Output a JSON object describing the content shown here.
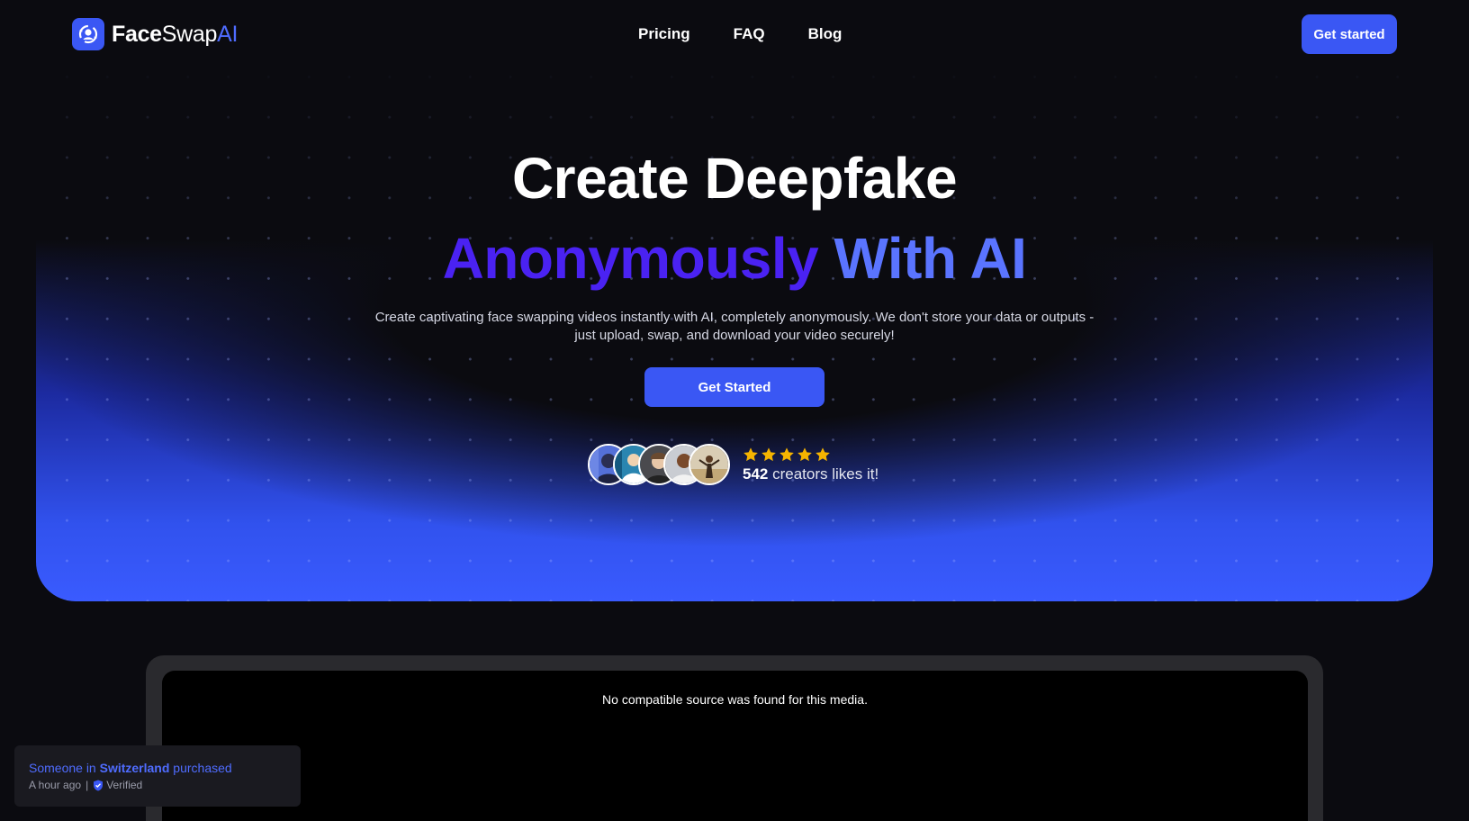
{
  "brand": {
    "part1": "Face",
    "part2": "Swap",
    "part3": "AI",
    "accent_color": "#3a57f4"
  },
  "nav": {
    "links": [
      "Pricing",
      "FAQ",
      "Blog"
    ],
    "cta_label": "Get started"
  },
  "hero": {
    "title_line1": "Create Deepfake",
    "title_line2_part1": "Anonymously",
    "title_line2_part2": "With AI",
    "subtitle_line1": "Create captivating face swapping videos instantly with AI, completely anonymously. We don't store your data or outputs -",
    "subtitle_line2": "just upload, swap, and download your video securely!",
    "cta_label": "Get Started",
    "rating_stars": 5,
    "likes_count": "542",
    "likes_text": "creators likes it!",
    "avatar_icons": [
      "avatar-1",
      "avatar-2",
      "avatar-3",
      "avatar-4",
      "avatar-5"
    ]
  },
  "video": {
    "message": "No compatible source was found for this media."
  },
  "toast": {
    "prefix": "Someone in",
    "location": "Switzerland",
    "suffix": "purchased",
    "time": "A hour ago",
    "separator": "|",
    "verified_label": "Verified"
  },
  "colors": {
    "background": "#0b0b10",
    "primary": "#3a57f4",
    "title_purple": "#4a22f2",
    "title_blue": "#5a74ff",
    "star": "#f5b400"
  }
}
